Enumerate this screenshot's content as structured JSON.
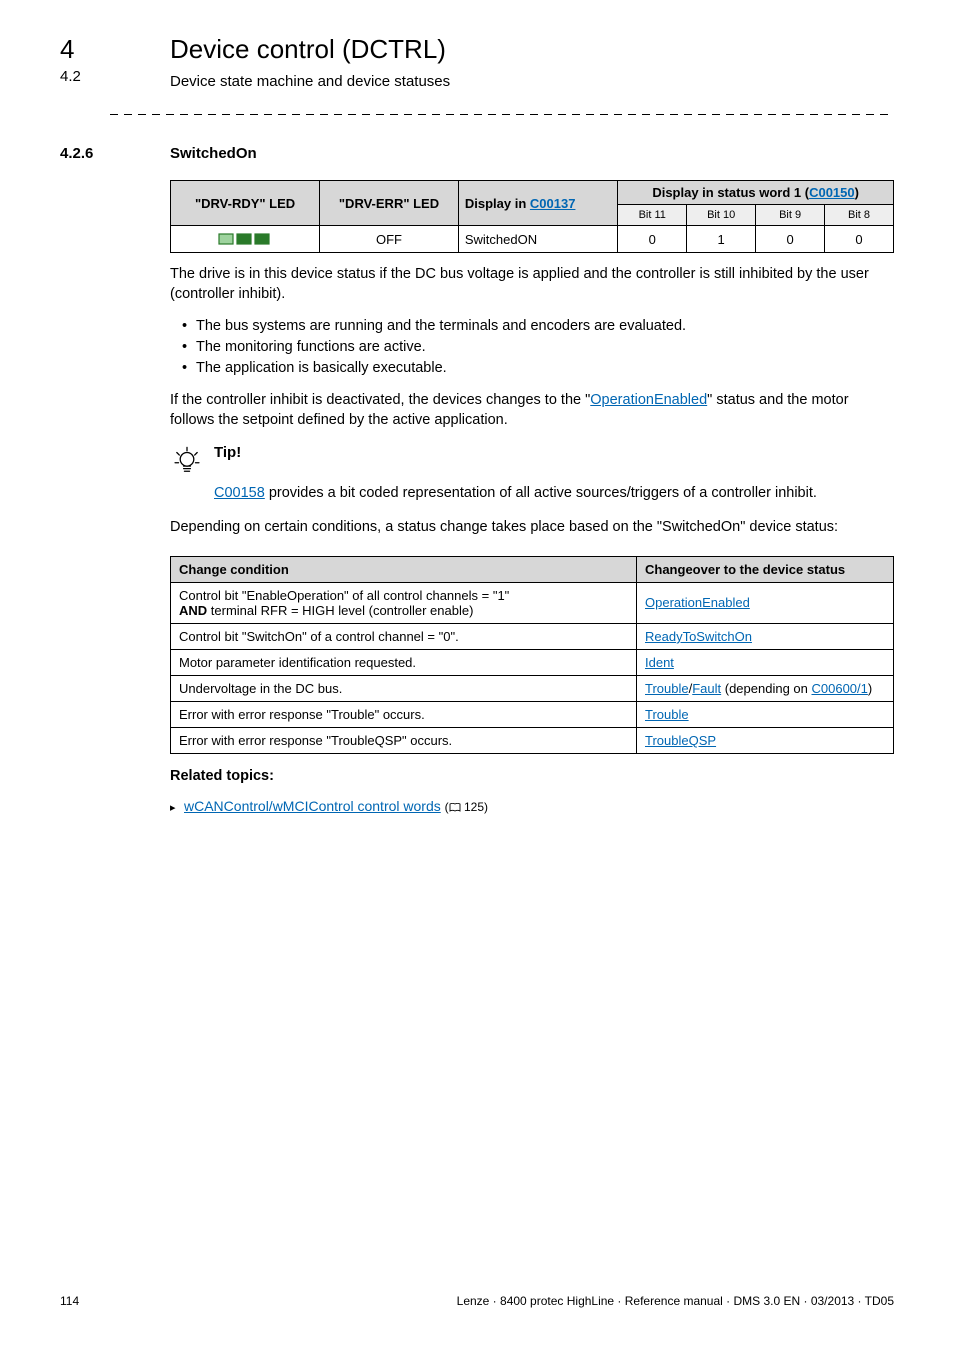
{
  "header": {
    "chapter_num": "4",
    "chapter_title": "Device control (DCTRL)",
    "sub_num": "4.2",
    "sub_title": "Device state machine and device statuses"
  },
  "section": {
    "num": "4.2.6",
    "title": "SwitchedOn"
  },
  "table1": {
    "h_drv_rdy": "\"DRV-RDY\" LED",
    "h_drv_err": "\"DRV-ERR\" LED",
    "h_display_in": "Display in ",
    "h_display_in_link": "C00137",
    "h_status_word": "Display in status word 1 (",
    "h_status_word_link": "C00150",
    "h_status_word_close": ")",
    "sub_bit11": "Bit 11",
    "sub_bit10": "Bit 10",
    "sub_bit9": "Bit 9",
    "sub_bit8": "Bit 8",
    "r_drv_err": "OFF",
    "r_display_in": "SwitchedON",
    "r_b11": "0",
    "r_b10": "1",
    "r_b9": "0",
    "r_b8": "0"
  },
  "para1_a": "The drive is in this device status if the DC bus voltage is applied and the controller is still inhibited by the user (controller inhibit).",
  "bullets1": [
    "The bus systems are running and the terminals and encoders are evaluated.",
    "The monitoring functions are active.",
    "The application is basically executable."
  ],
  "para2_a": "If the controller inhibit is deactivated, the devices changes to the \"",
  "para2_link": "OperationEnabled",
  "para2_b": "\" status and the motor follows the setpoint defined by the active application.",
  "tip": {
    "label": "Tip!",
    "body_link": "C00158",
    "body_text": " provides a bit coded representation of all active sources/triggers of a controller inhibit."
  },
  "para3": "Depending on certain conditions, a status change takes place based on the \"SwitchedOn\" device status:",
  "table2": {
    "h_cond": "Change condition",
    "h_change": "Changeover to the device status",
    "rows": [
      {
        "cond_a": "Control bit \"EnableOperation\" of all control channels = \"1\"",
        "cond_b_bold": "AND",
        "cond_b_rest": " terminal RFR = HIGH level (controller enable)",
        "links": [
          {
            "t": "OperationEnabled"
          }
        ]
      },
      {
        "cond_a": "Control bit \"SwitchOn\" of a control channel = \"0\".",
        "links": [
          {
            "t": "ReadyToSwitchOn"
          }
        ]
      },
      {
        "cond_a": "Motor parameter identification requested.",
        "links": [
          {
            "t": "Ident"
          }
        ]
      },
      {
        "cond_a": "Undervoltage in the DC bus.",
        "links": [
          {
            "t": "Trouble"
          },
          {
            "t": "/",
            "plain": true
          },
          {
            "t": "Fault"
          },
          {
            "t": " (depending on ",
            "plain": true
          },
          {
            "t": "C00600/1"
          },
          {
            "t": ")",
            "plain": true
          }
        ]
      },
      {
        "cond_a": "Error with error response \"Trouble\" occurs.",
        "links": [
          {
            "t": "Trouble"
          }
        ]
      },
      {
        "cond_a": "Error with error response \"TroubleQSP\" occurs.",
        "links": [
          {
            "t": "TroubleQSP"
          }
        ]
      }
    ]
  },
  "related": {
    "head": "Related topics:",
    "item_link": "wCANControl/wMCIControl control words",
    "item_ref": "125)"
  },
  "footer": {
    "page": "114",
    "right": "Lenze · 8400 protec HighLine · Reference manual · DMS 3.0 EN · 03/2013 · TD05"
  }
}
